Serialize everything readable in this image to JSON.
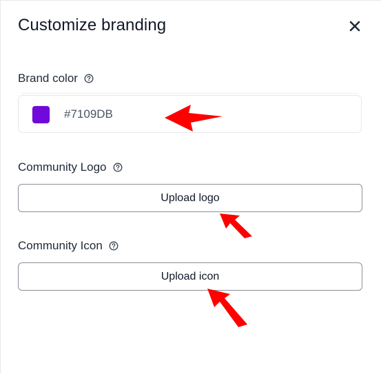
{
  "dialog": {
    "title": "Customize branding",
    "close_icon": "close-icon"
  },
  "brand_color": {
    "label": "Brand color",
    "help_icon": "help-circle-icon",
    "value": "#7109DB",
    "swatch_color": "#7109DB"
  },
  "community_logo": {
    "label": "Community Logo",
    "help_icon": "help-circle-icon",
    "button_label": "Upload logo"
  },
  "community_icon": {
    "label": "Community Icon",
    "help_icon": "help-circle-icon",
    "button_label": "Upload icon"
  },
  "annotations": {
    "arrow_color": "#ff0000"
  }
}
